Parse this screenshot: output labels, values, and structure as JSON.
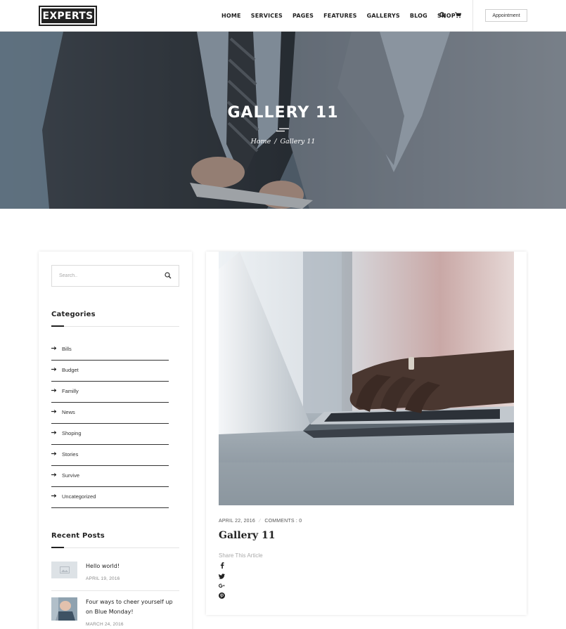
{
  "header": {
    "logo_text": "EXPERTS",
    "nav": [
      "HOME",
      "SERVICES",
      "PAGES",
      "FEATURES",
      "GALLERYS",
      "BLOG",
      "SHOP"
    ],
    "icons": [
      "search-icon",
      "cart-icon"
    ],
    "appointment_label": "Appointment"
  },
  "hero": {
    "title": "GALLERY 11",
    "breadcrumb_home": "Home",
    "breadcrumb_sep": "/",
    "breadcrumb_current": "Gallery 11"
  },
  "sidebar": {
    "search_placeholder": "Search..",
    "categories_title": "Categories",
    "categories": [
      "Bills",
      "Budget",
      "Familly",
      "News",
      "Shoping",
      "Stories",
      "Survive",
      "Uncategorized"
    ],
    "recent_title": "Recent Posts",
    "recent_posts": [
      {
        "title": "Hello world!",
        "date": "APRIL 19, 2016"
      },
      {
        "title": "Four ways to cheer yourself up on Blue Monday!",
        "date": "MARCH 24, 2016"
      }
    ]
  },
  "post": {
    "date": "APRIL 22, 2016",
    "comments": "COMMENTS : 0",
    "title": "Gallery 11",
    "share_label": "Share This Article",
    "share_icons": [
      "facebook-icon",
      "twitter-icon",
      "google-plus-icon",
      "pinterest-icon"
    ]
  },
  "colors": {
    "text_dark": "#222222",
    "border": "#e3e3e3",
    "muted": "#888888"
  }
}
